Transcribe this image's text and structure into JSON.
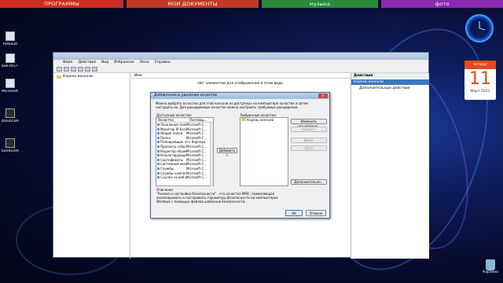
{
  "topbar": [
    {
      "label": "ПРОГРАММЫ",
      "color": "#cc2d1f"
    },
    {
      "label": "МОИ ДОКУМЕНТЫ",
      "color": "#c23a22"
    },
    {
      "label": "музыка",
      "color": "#2a8a3a"
    },
    {
      "label": "фото",
      "color": "#8a2ab0"
    }
  ],
  "desktop_icons": [
    {
      "label": "hsfeault"
    },
    {
      "label": "ba67657-7..."
    },
    {
      "label": "Microsoft..."
    },
    {
      "label": "bandicam 2021-03-11..."
    },
    {
      "label": "bandicam 2021-03-11..."
    }
  ],
  "calendar": {
    "weekday": "четверг",
    "day": "11",
    "month_year": "Март 2021"
  },
  "recycle_bin": {
    "label": "Корзина"
  },
  "mmc": {
    "menu": [
      "Файл",
      "Действие",
      "Вид",
      "Избранное",
      "Окно",
      "Справка"
    ],
    "tree_root": "Корень консоли",
    "column_header": "Имя",
    "empty_message": "Нет элементов для отображения в этом виде.",
    "actions_title": "Действия",
    "actions_selected": "Корень консоли",
    "actions_item": "Дополнительные действия"
  },
  "dialog": {
    "title": "Добавление и удаление оснасток",
    "intro": "Можно выбрать оснастки для этой консоли из доступных на компьютере оснасток и затем настроить их. Для расширяемых оснасток можно настроить требуемые расширения.",
    "available_label": "Доступные оснастки:",
    "selected_label": "Выбранные оснастки:",
    "col_snapin": "Оснастка",
    "col_vendor": "Поставщ...",
    "snapins": [
      {
        "name": "Локальные пользо...",
        "vendor": "Microsoft C..."
      },
      {
        "name": "Монитор IP-безоп...",
        "vendor": "Microsoft C..."
      },
      {
        "name": "Общие папки",
        "vendor": "Microsoft C..."
      },
      {
        "name": "Папка",
        "vendor": "Microsoft C..."
      },
      {
        "name": "Планировщик за...",
        "vendor": "(с) Корпора..."
      },
      {
        "name": "Просмотр событий",
        "vendor": "Microsoft C..."
      },
      {
        "name": "Редактор объект...",
        "vendor": "Microsoft C..."
      },
      {
        "name": "Результирующая...",
        "vendor": "Microsoft C..."
      },
      {
        "name": "Сертификаты",
        "vendor": "Microsoft C..."
      },
      {
        "name": "Системный монит...",
        "vendor": "Microsoft C..."
      },
      {
        "name": "Службы",
        "vendor": "Microsoft C..."
      },
      {
        "name": "Службы компоне...",
        "vendor": "Microsoft C..."
      },
      {
        "name": "Ссылка на веб-р...",
        "vendor": "Microsoft C..."
      }
    ],
    "selected_item": "Корень консоли",
    "buttons": {
      "add": "Добавить >",
      "edit_extensions": "Изменить расширения...",
      "remove": "Удалить",
      "move_up": "Вверх",
      "move_down": "Вниз",
      "advanced": "Дополнительно...",
      "ok": "ОК",
      "cancel": "Отмена"
    },
    "description_label": "Описание:",
    "description_text": "\"Анализ и настройка безопасности\" - это оснастка MMC, позволяющая анализировать и настраивать параметры безопасности на компьютерах Windows с помощью файлов шаблонов безопасности."
  }
}
